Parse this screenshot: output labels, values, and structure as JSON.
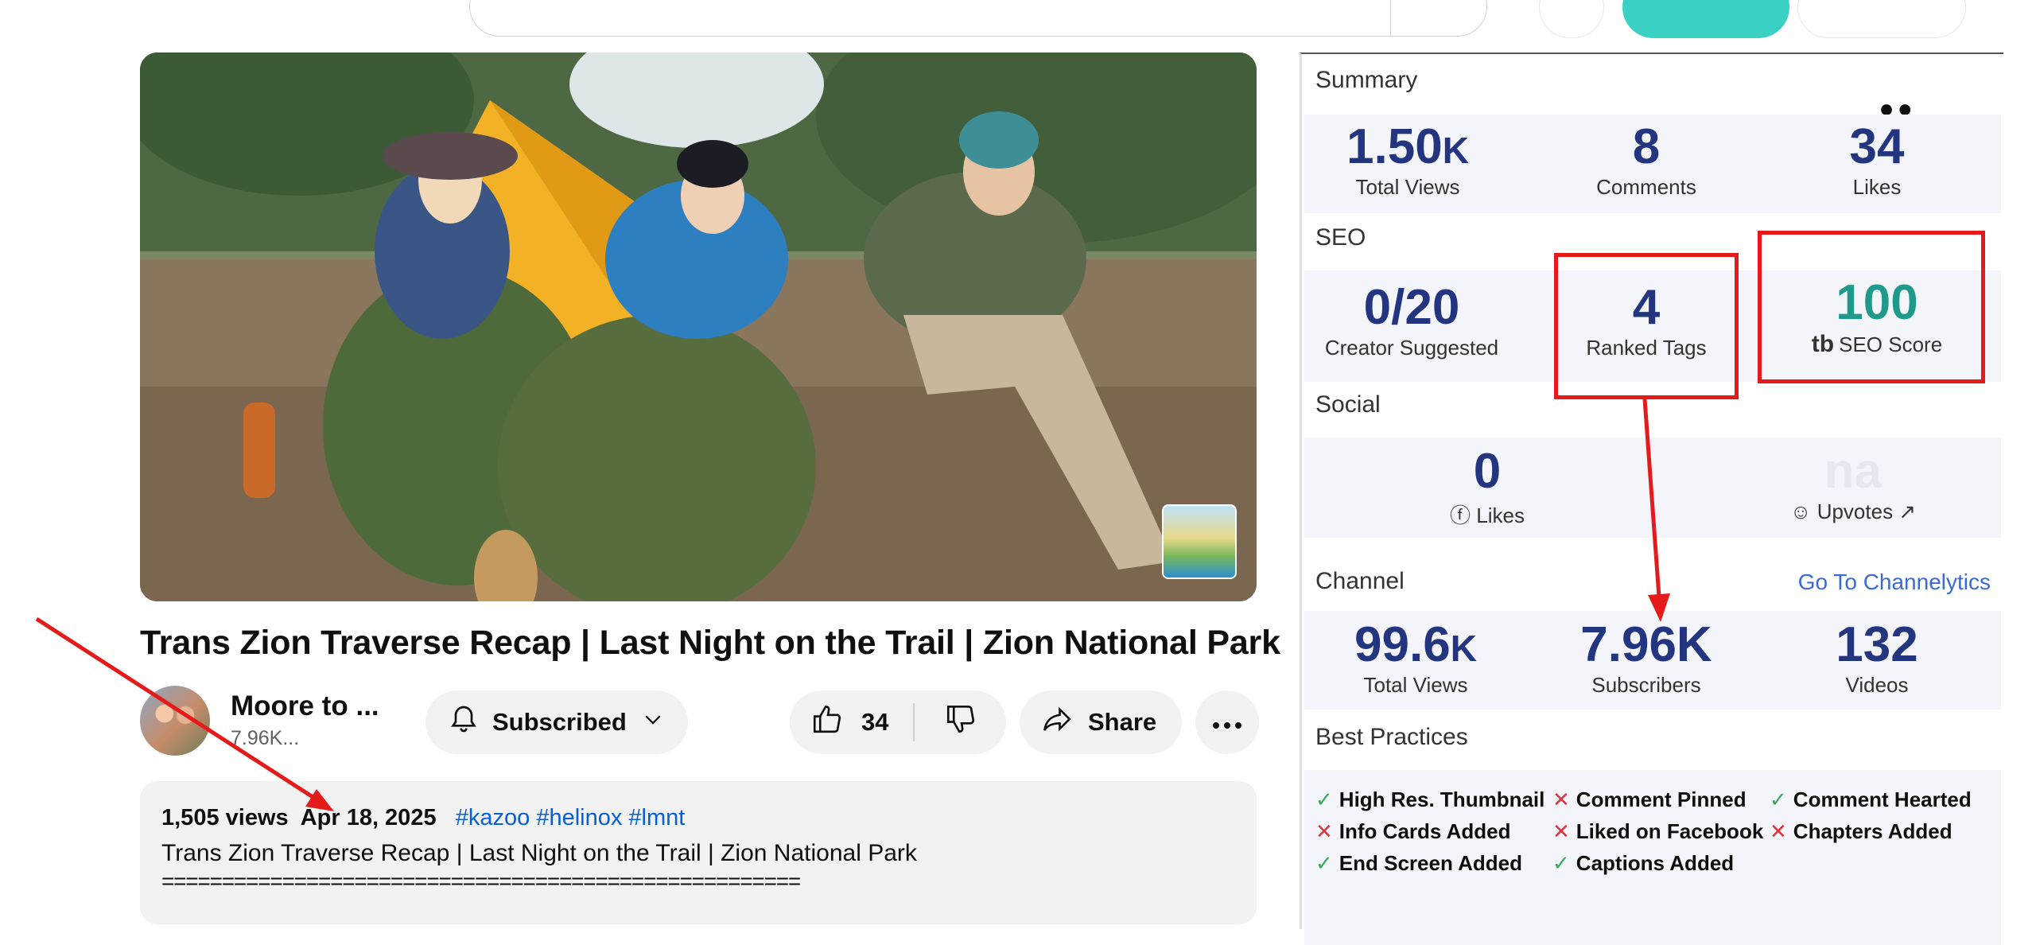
{
  "video": {
    "title": "Trans Zion Traverse Recap | Last Night on the Trail | Zion National Park"
  },
  "channel": {
    "name": "Moore to ...",
    "subscribers": "7.96K..."
  },
  "actions": {
    "subscribed_label": "Subscribed",
    "like_count": "34",
    "share_label": "Share"
  },
  "description": {
    "views": "1,505 views",
    "date": "Apr 18, 2025",
    "tags": [
      "#kazoo",
      "#helinox",
      "#lmnt"
    ],
    "line1": "Trans Zion Traverse Recap | Last Night on the Trail | Zion National Park",
    "separator": "====================================================="
  },
  "panel": {
    "summary": {
      "label": "Summary",
      "total_views_num": "1.50",
      "total_views_unit": "K",
      "total_views_label": "Total Views",
      "comments_num": "8",
      "comments_label": "Comments",
      "likes_num": "34",
      "likes_label": "Likes"
    },
    "seo": {
      "label": "SEO",
      "creator_suggested_num": "0/20",
      "creator_suggested_label": "Creator Suggested",
      "ranked_tags_num": "4",
      "ranked_tags_label": "Ranked Tags",
      "seo_score_num": "100",
      "seo_score_label": "SEO Score"
    },
    "social": {
      "label": "Social",
      "likes_num": "0",
      "likes_label": "Likes",
      "upvotes_num": "na",
      "upvotes_label": "Upvotes"
    },
    "channel": {
      "label": "Channel",
      "link": "Go To Channelytics",
      "total_views_num": "99.6",
      "total_views_unit": "K",
      "total_views_label": "Total Views",
      "subscribers_num": "7.96K",
      "subscribers_label": "Subscribers",
      "videos_num": "132",
      "videos_label": "Videos"
    },
    "best_practices": {
      "label": "Best Practices",
      "items": [
        {
          "text": "High Res. Thumbnail",
          "ok": true
        },
        {
          "text": "Comment Pinned",
          "ok": false
        },
        {
          "text": "Comment Hearted",
          "ok": true
        },
        {
          "text": "Info Cards Added",
          "ok": false
        },
        {
          "text": "Liked on Facebook",
          "ok": false
        },
        {
          "text": "Chapters Added",
          "ok": false
        },
        {
          "text": "End Screen Added",
          "ok": true
        },
        {
          "text": "Captions Added",
          "ok": true
        }
      ]
    }
  },
  "colors": {
    "accent_red": "#e51b1b",
    "stat_blue": "#23357f",
    "seo_teal": "#1f9a8a",
    "link_blue": "#065fd4"
  }
}
